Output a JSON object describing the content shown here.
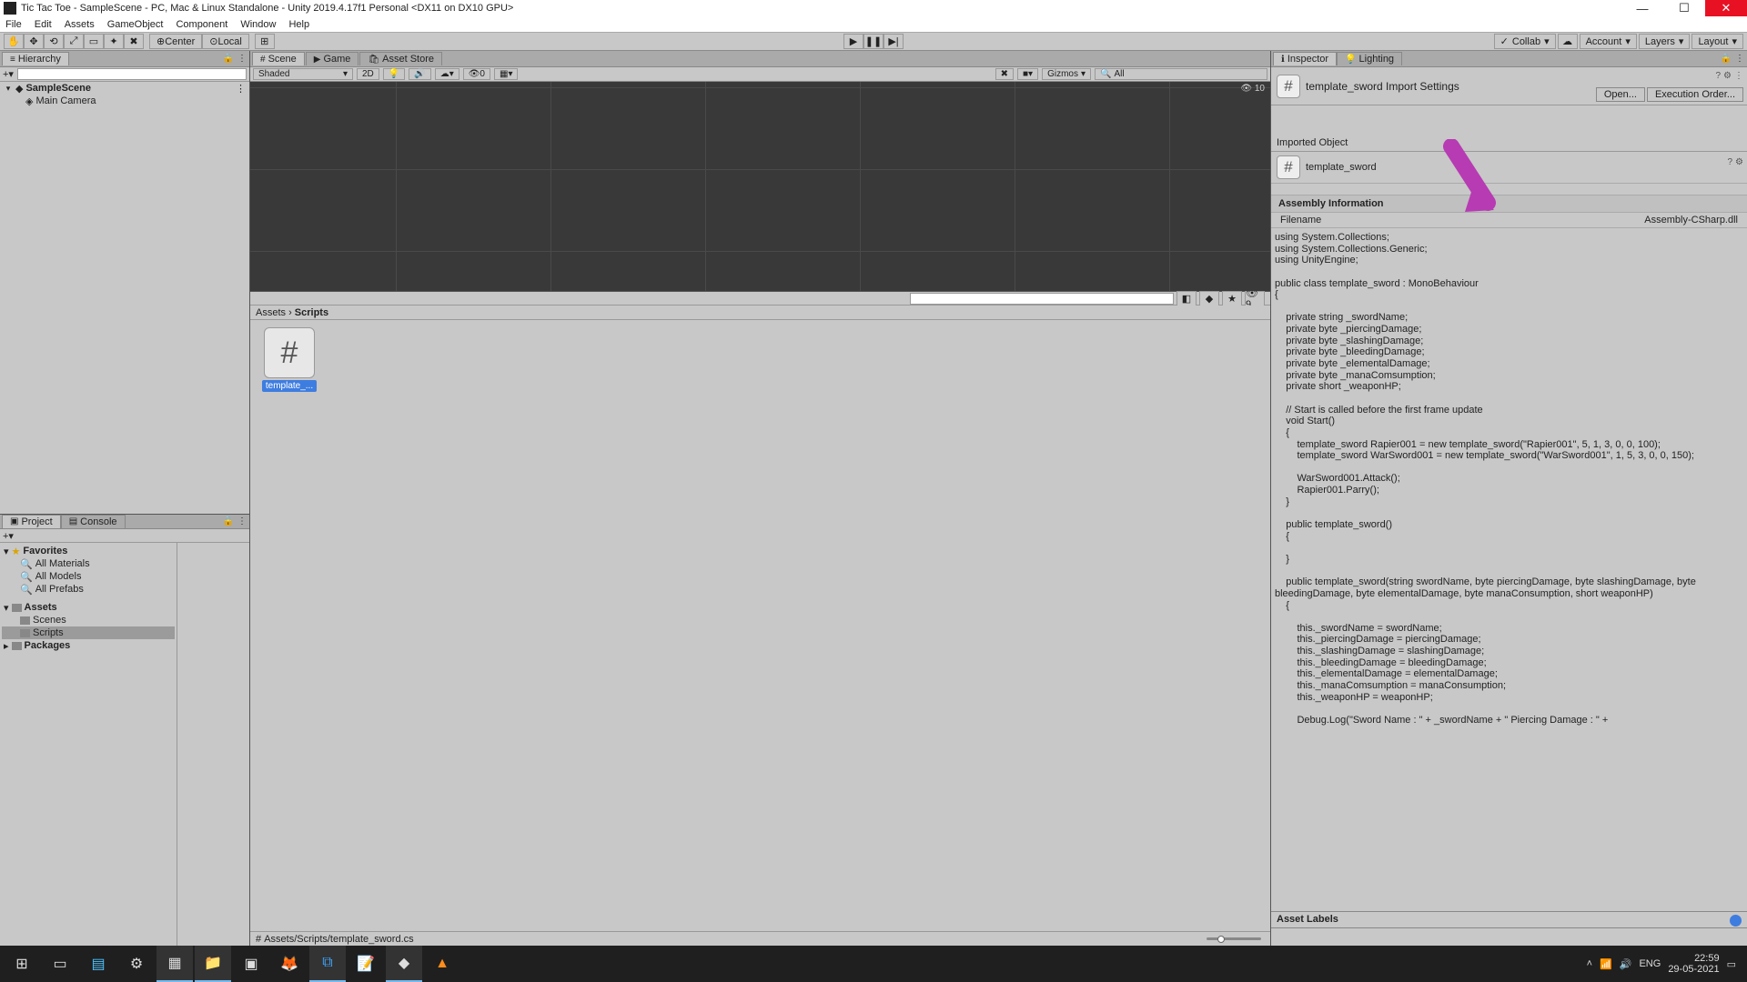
{
  "titlebar": {
    "text": "Tic Tac Toe - SampleScene - PC, Mac & Linux Standalone - Unity 2019.4.17f1 Personal <DX11 on DX10 GPU>"
  },
  "menu": {
    "items": [
      "File",
      "Edit",
      "Assets",
      "GameObject",
      "Component",
      "Window",
      "Help"
    ]
  },
  "toolbar": {
    "center": "Center",
    "local": "Local",
    "collab": "Collab",
    "account": "Account",
    "layers": "Layers",
    "layout": "Layout"
  },
  "hierarchy": {
    "tab": "Hierarchy",
    "scene": "SampleScene",
    "items": [
      "Main Camera"
    ]
  },
  "sceneTabs": {
    "scene": "Scene",
    "game": "Game",
    "assetStore": "Asset Store"
  },
  "sceneToolbar": {
    "shaded": "Shaded",
    "twoD": "2D",
    "gizmos": "Gizmos",
    "all": "All",
    "count": "10"
  },
  "projectTabs": {
    "project": "Project",
    "console": "Console"
  },
  "projectSearch": {
    "placeholder": ""
  },
  "projectTree": {
    "favorites": "Favorites",
    "favChildren": [
      "All Materials",
      "All Models",
      "All Prefabs"
    ],
    "assets": "Assets",
    "assetChildren": [
      "Scenes",
      "Scripts"
    ],
    "packages": "Packages"
  },
  "breadcrumb": {
    "p1": "Assets",
    "p2": "Scripts"
  },
  "asset": {
    "name": "template_..."
  },
  "projectFooter": {
    "path": "Assets/Scripts/template_sword.cs"
  },
  "inspector": {
    "tab": "Inspector",
    "lighting": "Lighting",
    "title": "template_sword Import Settings",
    "open": "Open...",
    "execOrder": "Execution Order...",
    "importedObject": "Imported Object",
    "objName": "template_sword",
    "assemblyHdr": "Assembly Information",
    "filenameK": "Filename",
    "filenameV": "Assembly-CSharp.dll",
    "assetLabels": "Asset Labels"
  },
  "code": "using System.Collections;\nusing System.Collections.Generic;\nusing UnityEngine;\n\npublic class template_sword : MonoBehaviour\n{\n\n    private string _swordName;\n    private byte _piercingDamage;\n    private byte _slashingDamage;\n    private byte _bleedingDamage;\n    private byte _elementalDamage;\n    private byte _manaComsumption;\n    private short _weaponHP;\n\n    // Start is called before the first frame update\n    void Start()\n    {\n        template_sword Rapier001 = new template_sword(\"Rapier001\", 5, 1, 3, 0, 0, 100);\n        template_sword WarSword001 = new template_sword(\"WarSword001\", 1, 5, 3, 0, 0, 150);\n\n        WarSword001.Attack();\n        Rapier001.Parry();\n    }\n\n    public template_sword()\n    {\n\n    }\n\n    public template_sword(string swordName, byte piercingDamage, byte slashingDamage, byte bleedingDamage, byte elementalDamage, byte manaConsumption, short weaponHP)\n    {\n\n        this._swordName = swordName;\n        this._piercingDamage = piercingDamage;\n        this._slashingDamage = slashingDamage;\n        this._bleedingDamage = bleedingDamage;\n        this._elementalDamage = elementalDamage;\n        this._manaComsumption = manaConsumption;\n        this._weaponHP = weaponHP;\n\n        Debug.Log(\"Sword Name : \" + _swordName + \" Piercing Damage : \" +",
  "tray": {
    "lang": "ENG",
    "time": "22:59",
    "date": "29-05-2021"
  }
}
